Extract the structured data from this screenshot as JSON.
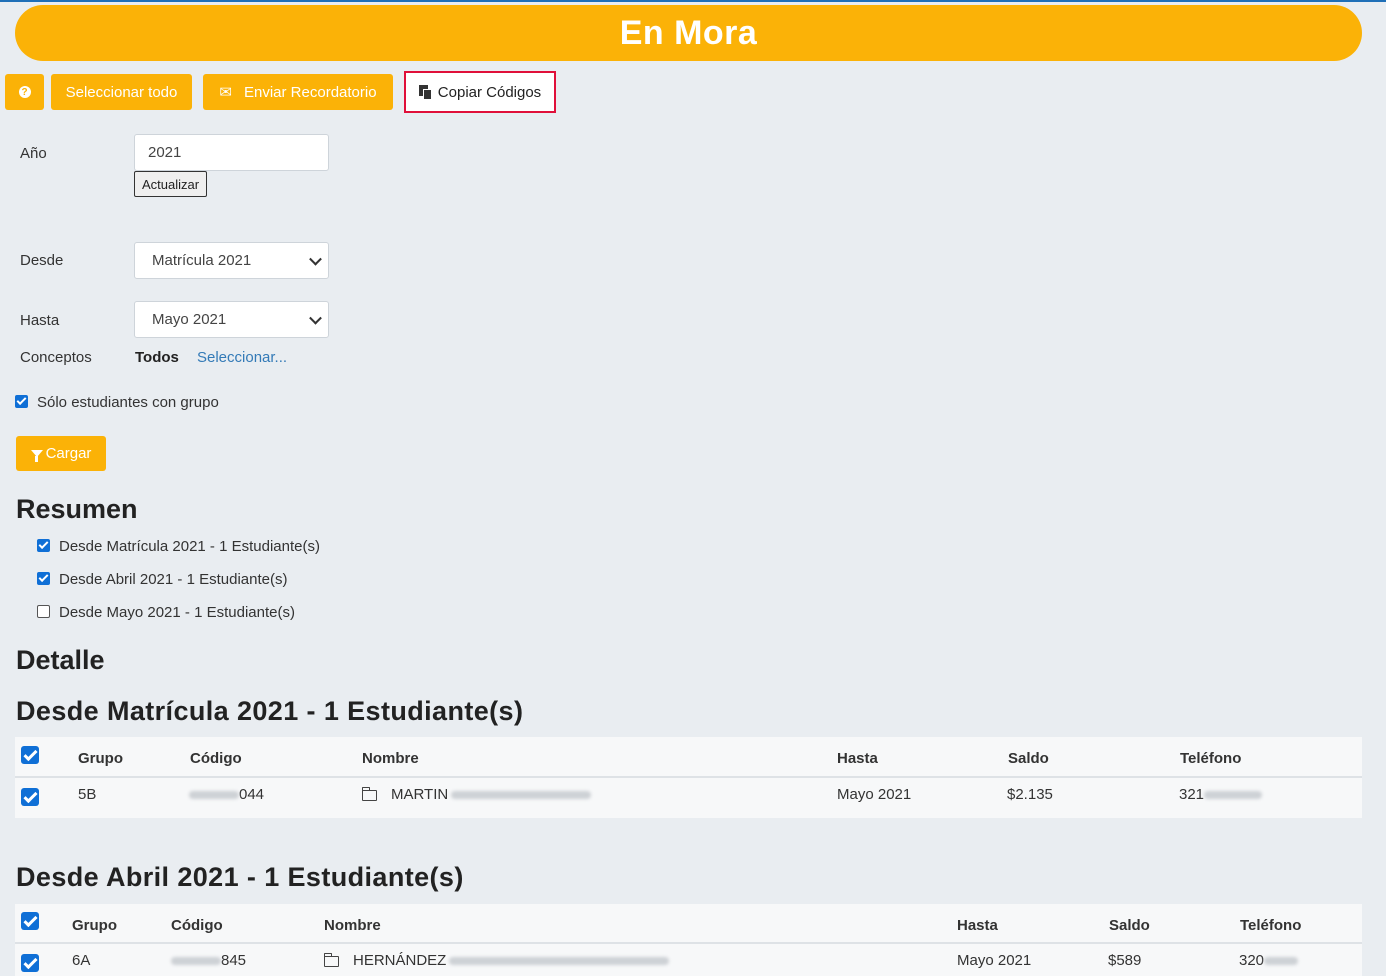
{
  "header": {
    "title": "En Mora"
  },
  "toolbar": {
    "help_glyph": "?",
    "select_all_label": "Seleccionar todo",
    "remind_label": "Enviar Recordatorio",
    "copy_label": "Copiar Códigos"
  },
  "filters": {
    "year_label": "Año",
    "year_value": "2021",
    "update_label": "Actualizar",
    "from_label": "Desde",
    "from_value": "Matrícula 2021",
    "to_label": "Hasta",
    "to_value": "Mayo 2021",
    "concepts_label": "Conceptos",
    "concepts_value": "Todos",
    "concepts_link": "Seleccionar...",
    "only_group_label": "Sólo estudiantes con grupo",
    "only_group_checked": true,
    "load_label": "Cargar"
  },
  "summary": {
    "heading": "Resumen",
    "items": [
      {
        "label": "Desde Matrícula 2021 - 1 Estudiante(s)",
        "checked": true
      },
      {
        "label": "Desde Abril 2021 - 1 Estudiante(s)",
        "checked": true
      },
      {
        "label": "Desde Mayo 2021 - 1 Estudiante(s)",
        "checked": false
      }
    ]
  },
  "detail": {
    "heading": "Detalle",
    "columns": [
      "Grupo",
      "Código",
      "Nombre",
      "Hasta",
      "Saldo",
      "Teléfono"
    ],
    "sections": [
      {
        "title": "Desde Matrícula 2021 - 1 Estudiante(s)",
        "rows": [
          {
            "grupo": "5B",
            "codigo": "044",
            "nombre": "MARTIN",
            "hasta": "Mayo 2021",
            "saldo": "$2.135",
            "telefono": "321",
            "checked": true
          }
        ]
      },
      {
        "title": "Desde Abril 2021 - 1 Estudiante(s)",
        "rows": [
          {
            "grupo": "6A",
            "codigo": "845",
            "nombre": "HERNÁNDEZ",
            "hasta": "Mayo 2021",
            "saldo": "$589",
            "telefono": "320",
            "checked": true
          }
        ]
      }
    ]
  },
  "colors": {
    "accent": "#fbb207",
    "highlight": "#e0103a",
    "link": "#337ab7",
    "checkbox": "#0f6fd6"
  },
  "icons": [
    "help-icon",
    "envelope-icon",
    "copy-icon",
    "chevron-down-icon",
    "filter-icon",
    "folder-icon"
  ]
}
